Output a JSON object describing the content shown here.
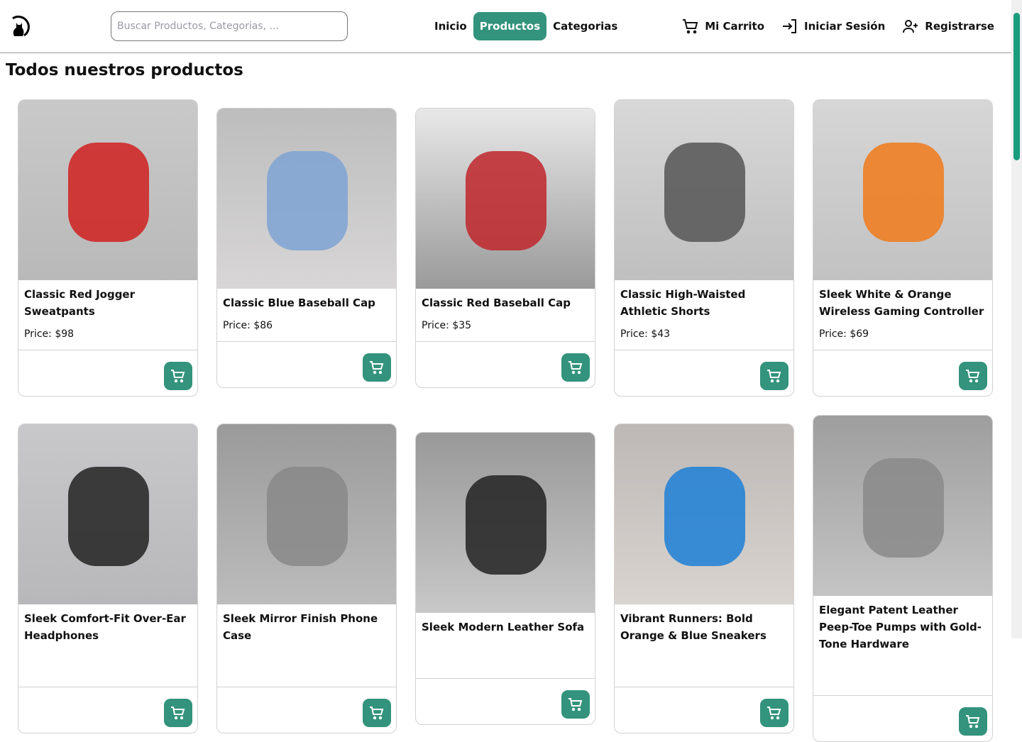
{
  "nav": {
    "search_placeholder": "Buscar Productos, Categorias, ...",
    "links": [
      "Inicio",
      "Productos",
      "Categorias"
    ],
    "active": "Productos",
    "cart": "Mi Carrito",
    "login": "Iniciar Sesión",
    "register": "Registrarse"
  },
  "accent": "#33937c",
  "page_title": "Todos nuestros productos",
  "products": [
    {
      "title": "Classic Red Jogger Sweatpants",
      "price": "Price: $98",
      "img": "linear-gradient(#c9c9c9,#b9b9b9)",
      "obj": "#d0201e"
    },
    {
      "title": "Classic Blue Baseball Cap",
      "price": "Price: $86",
      "img": "linear-gradient(#bdbdbd,#d8d6d6)",
      "obj": "#7ea3d3"
    },
    {
      "title": "Classic Red Baseball Cap",
      "price": "Price: $35",
      "img": "linear-gradient(#e8e8e8,#9a9a9a)",
      "obj": "#c0262b"
    },
    {
      "title": "Classic High-Waisted Athletic Shorts",
      "price": "Price: $43",
      "img": "linear-gradient(#d8d8d8,#bfbfbf)",
      "obj": "#555"
    },
    {
      "title": "Sleek White & Orange Wireless Gaming Controller",
      "price": "Price: $69",
      "img": "linear-gradient(#d6d6d6,#c2c2c2)",
      "obj": "#f07a1a"
    },
    {
      "title": "Sleek Comfort-Fit Over-Ear Headphones",
      "price": "",
      "img": "linear-gradient(#c8c8ca,#b8b8ba)",
      "obj": "#222"
    },
    {
      "title": "Sleek Mirror Finish Phone Case",
      "price": "",
      "img": "linear-gradient(#9a9a9a,#bcbcbc)",
      "obj": "#888"
    },
    {
      "title": "Sleek Modern Leather Sofa",
      "price": "",
      "img": "linear-gradient(#999,#c8c8c8)",
      "obj": "#222"
    },
    {
      "title": "Vibrant Runners: Bold Orange & Blue Sneakers",
      "price": "",
      "img": "linear-gradient(#bdb8b5,#d9d4d0)",
      "obj": "#1c7fd6"
    },
    {
      "title": "Elegant Patent Leather Peep-Toe Pumps with Gold-Tone Hardware",
      "price": "",
      "img": "linear-gradient(#9e9e9e,#c4c4c4)",
      "obj": "#8a8a8a"
    }
  ]
}
